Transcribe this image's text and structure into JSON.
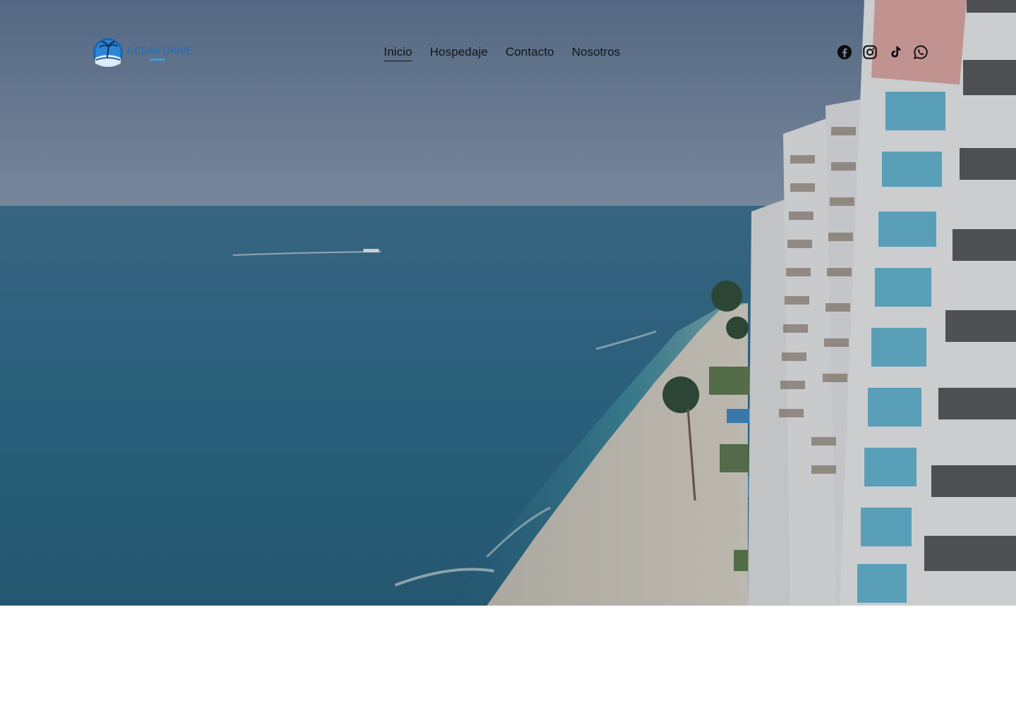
{
  "brand": {
    "name": "OCEAN DRIVE",
    "logo_icon": "palm-island-logo-icon",
    "color": "#1e6fbf"
  },
  "nav": {
    "items": [
      {
        "label": "Inicio",
        "active": true
      },
      {
        "label": "Hospedaje",
        "active": false
      },
      {
        "label": "Contacto",
        "active": false
      },
      {
        "label": "Nosotros",
        "active": false
      }
    ]
  },
  "social": {
    "icons": [
      "facebook-icon",
      "instagram-icon",
      "tiktok-icon",
      "whatsapp-icon"
    ]
  },
  "hero": {
    "image": "aerial-beach-condominiums",
    "colors": {
      "sky": "#6b8098",
      "sea": "#2b6f8a",
      "sand": "#d8d2c4",
      "building": "#e9e9e7"
    }
  }
}
